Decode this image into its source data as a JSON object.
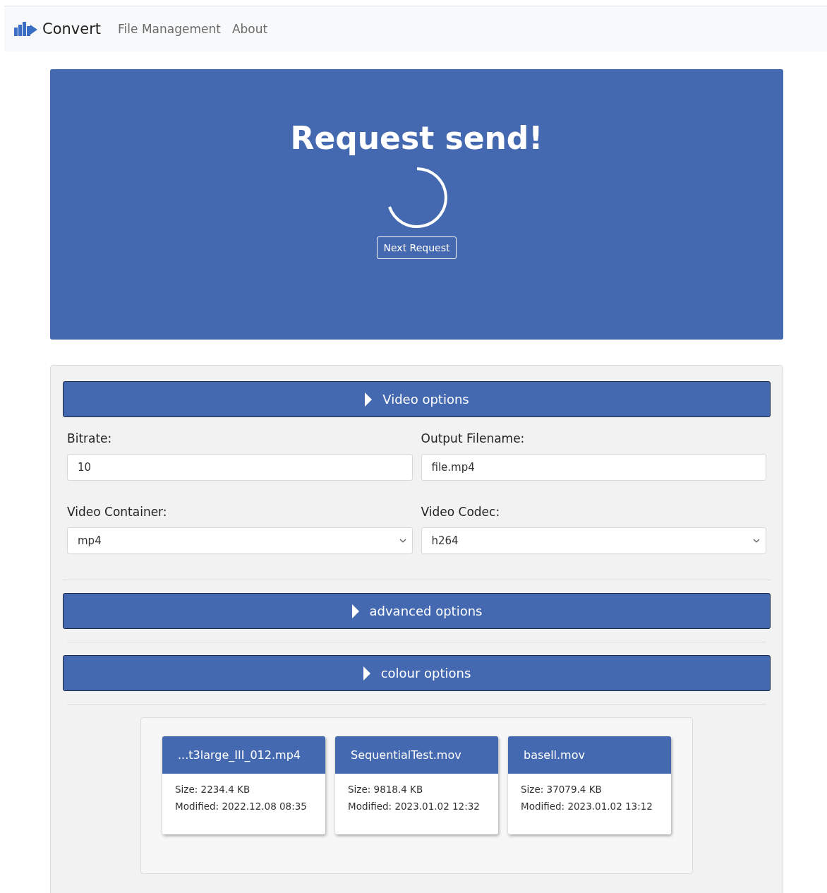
{
  "navbar": {
    "brand": "Convert",
    "links": [
      {
        "label": "File Management"
      },
      {
        "label": "About"
      }
    ]
  },
  "banner": {
    "title": "Request send!",
    "button": "Next Request"
  },
  "sections": [
    {
      "title": "Video options",
      "expanded": false,
      "fields": [
        {
          "label": "Bitrate:",
          "kind": "text",
          "value": "10"
        },
        {
          "label": "Output Filename:",
          "kind": "text",
          "value": "file.mp4"
        },
        {
          "label": "Video Container:",
          "kind": "select",
          "value": "mp4"
        },
        {
          "label": "Video Codec:",
          "kind": "select",
          "value": "h264"
        }
      ]
    },
    {
      "title": "advanced options",
      "expanded": false
    },
    {
      "title": "colour options",
      "expanded": false
    }
  ],
  "files": [
    {
      "name": "...t3large_III_012.mp4",
      "size": "Size: 2234.4 KB",
      "modified": "Modified: 2022.12.08 08:35"
    },
    {
      "name": "SequentialTest.mov",
      "size": "Size: 9818.4 KB",
      "modified": "Modified: 2023.01.02 12:32"
    },
    {
      "name": "basell.mov",
      "size": "Size: 37079.4 KB",
      "modified": "Modified: 2023.01.02 13:12"
    }
  ]
}
